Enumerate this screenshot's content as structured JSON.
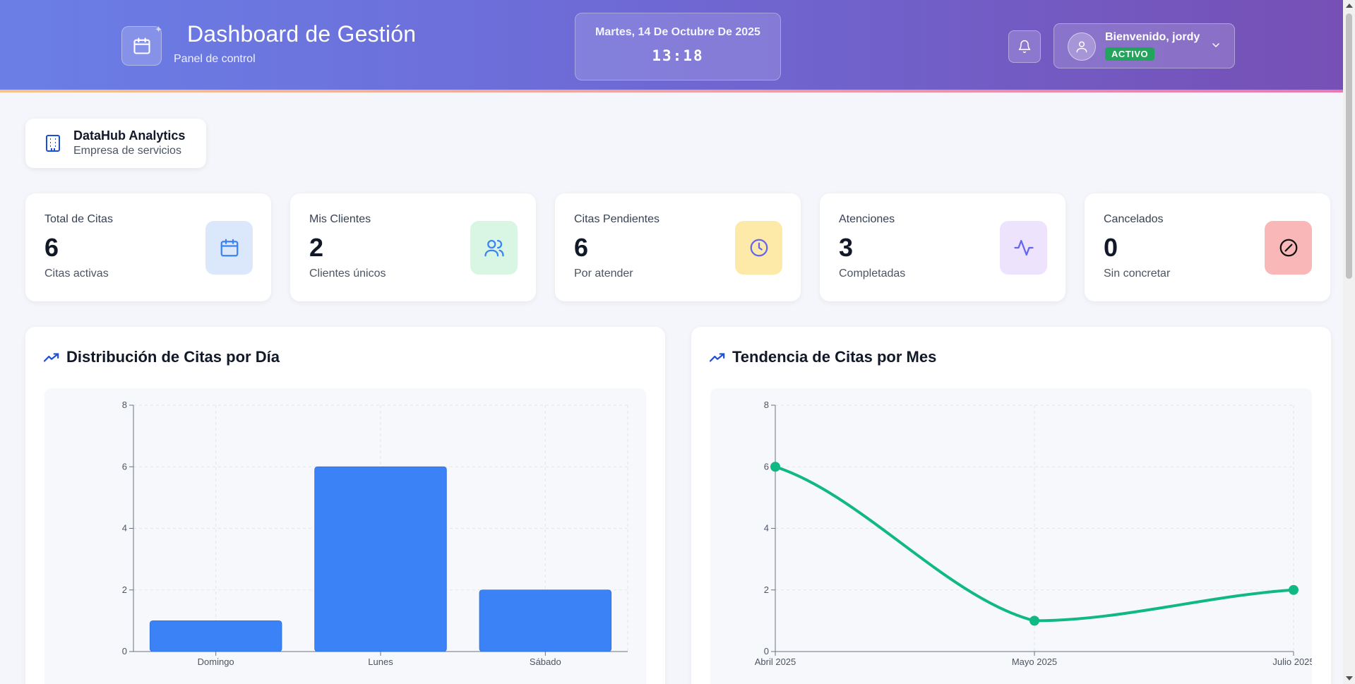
{
  "header": {
    "title": "Dashboard de Gestión",
    "subtitle": "Panel de control",
    "date": "Martes, 14 De Octubre De 2025",
    "time": "13:18",
    "user": {
      "welcome": "Bienvenido, jordy",
      "status": "ACTIVO"
    }
  },
  "company": {
    "name": "DataHub Analytics",
    "type": "Empresa de servicios"
  },
  "stats": [
    {
      "label": "Total de Citas",
      "value": "6",
      "desc": "Citas activas",
      "icon": "calendar-icon",
      "bg": "#dbe8fb",
      "color": "#3b82f6"
    },
    {
      "label": "Mis Clientes",
      "value": "2",
      "desc": "Clientes únicos",
      "icon": "users-icon",
      "bg": "#d9f6e5",
      "color": "#3b82f6"
    },
    {
      "label": "Citas Pendientes",
      "value": "6",
      "desc": "Por atender",
      "icon": "clock-icon",
      "bg": "#fde9a8",
      "color": "#6366f1"
    },
    {
      "label": "Atenciones",
      "value": "3",
      "desc": "Completadas",
      "icon": "activity-icon",
      "bg": "#ede3fd",
      "color": "#6366f1"
    },
    {
      "label": "Cancelados",
      "value": "0",
      "desc": "Sin concretar",
      "icon": "ban-icon",
      "bg": "#f9b7b7",
      "color": "#111111"
    }
  ],
  "charts": {
    "bar_title": "Distribución de Citas por Día",
    "line_title": "Tendencia de Citas por Mes"
  },
  "colors": {
    "bar": "#3b82f6",
    "line": "#10b981",
    "accent": "#1d4ed8"
  },
  "chart_data": [
    {
      "type": "bar",
      "title": "Distribución de Citas por Día",
      "categories": [
        "Domingo",
        "Lunes",
        "Sábado"
      ],
      "values": [
        1,
        6,
        2
      ],
      "ylim": [
        0,
        8
      ],
      "yticks": [
        0,
        2,
        4,
        6,
        8
      ],
      "grid": true
    },
    {
      "type": "line",
      "title": "Tendencia de Citas por Mes",
      "categories": [
        "Abril 2025",
        "Mayo 2025",
        "Julio 2025"
      ],
      "values": [
        6,
        1,
        2
      ],
      "ylim": [
        0,
        8
      ],
      "yticks": [
        0,
        2,
        4,
        6,
        8
      ],
      "grid": true
    }
  ]
}
